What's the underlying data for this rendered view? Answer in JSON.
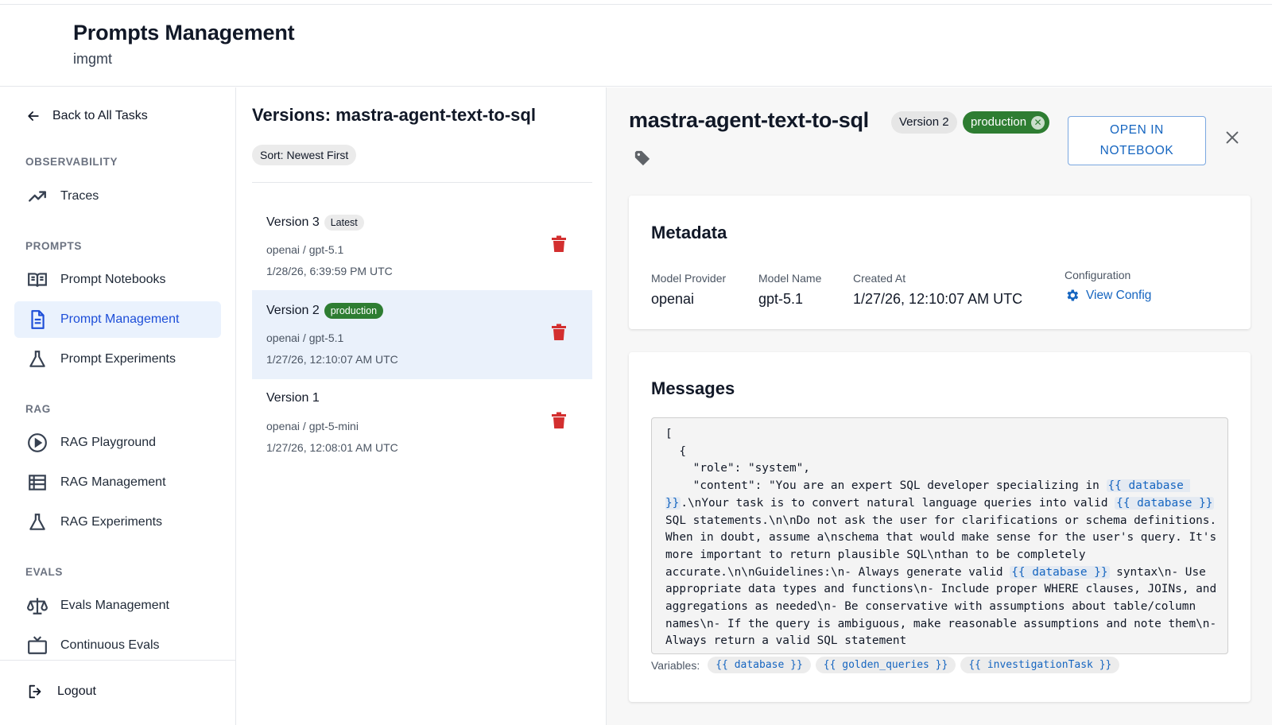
{
  "header": {
    "title": "Prompts Management",
    "subtitle": "imgmt"
  },
  "sidebar": {
    "back_label": "Back to All Tasks",
    "sections": {
      "observability": "OBSERVABILITY",
      "prompts": "PROMPTS",
      "rag": "RAG",
      "evals": "EVALS"
    },
    "items": {
      "traces": "Traces",
      "prompt_notebooks": "Prompt Notebooks",
      "prompt_management": "Prompt Management",
      "prompt_experiments": "Prompt Experiments",
      "rag_playground": "RAG Playground",
      "rag_management": "RAG Management",
      "rag_experiments": "RAG Experiments",
      "evals_management": "Evals Management",
      "continuous_evals": "Continuous Evals"
    },
    "active_item": "prompt_management",
    "logout_label": "Logout",
    "active_color": "#1d4ed8"
  },
  "versions": {
    "title": "Versions: mastra-agent-text-to-sql",
    "sort_label": "Sort: Newest First",
    "items": [
      {
        "label": "Version 3",
        "badge": "Latest",
        "model": "openai / gpt-5.1",
        "date": "1/28/26, 6:39:59 PM UTC"
      },
      {
        "label": "Version 2",
        "badge": "production",
        "model": "openai / gpt-5.1",
        "date": "1/27/26, 12:10:07 AM UTC",
        "selected": true
      },
      {
        "label": "Version 1",
        "model": "openai / gpt-5-mini",
        "date": "1/27/26, 12:08:01 AM UTC"
      }
    ]
  },
  "detail": {
    "title": "mastra-agent-text-to-sql",
    "version_chip": "Version 2",
    "env_chip": "production",
    "open_notebook_line1": "OPEN IN",
    "open_notebook_line2": "NOTEBOOK",
    "metadata": {
      "heading": "Metadata",
      "model_provider_label": "Model Provider",
      "model_provider": "openai",
      "model_name_label": "Model Name",
      "model_name": "gpt-5.1",
      "created_at_label": "Created At",
      "created_at": "1/27/26, 12:10:07 AM UTC",
      "configuration_label": "Configuration",
      "view_config_label": "View Config"
    },
    "messages": {
      "heading": "Messages",
      "code_lines": {
        "l1": "[",
        "l2": "  {",
        "l3": "    \"role\": \"system\",",
        "l4a": "    \"content\": \"You are an expert SQL developer specializing in ",
        "var1": "{{ database }}",
        "l4b": ".\\nYour task is to convert natural language queries into valid ",
        "var2": "{{ database }}",
        "l4c": " SQL statements.\\n\\nDo not ask the user for clarifications or schema definitions. When in doubt, assume a\\nschema that would make sense for the user's query. It's more important to return plausible SQL\\nthan to be completely accurate.\\n\\nGuidelines:\\n- Always generate valid ",
        "var3": "{{ database }}",
        "l4d": " syntax\\n- Use appropriate data types and functions\\n- Include proper WHERE clauses, JOINs, and aggregations as needed\\n- Be conservative with assumptions about table/column names\\n- If the query is ambiguous, make reasonable assumptions and note them\\n- Always return a valid SQL statement"
      },
      "variables_label": "Variables:",
      "variables": [
        "{{ database }}",
        "{{ golden_queries }}",
        "{{ investigationTask }}"
      ]
    }
  },
  "colors": {
    "production_green": "#2e7d32",
    "link_blue": "#1565c0",
    "delete_red": "#d32f2f",
    "selected_bg": "#eaf1fb"
  }
}
